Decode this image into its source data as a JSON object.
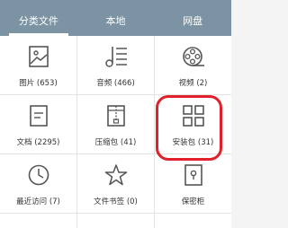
{
  "tabs": [
    {
      "label": "分类文件",
      "active": true
    },
    {
      "label": "本地",
      "active": false
    },
    {
      "label": "网盘",
      "active": false
    }
  ],
  "categories": [
    {
      "label": "图片 (653)",
      "icon": "image-icon"
    },
    {
      "label": "音频 (466)",
      "icon": "music-icon"
    },
    {
      "label": "视频 (2)",
      "icon": "video-reel-icon"
    },
    {
      "label": "文档 (2295)",
      "icon": "document-icon"
    },
    {
      "label": "压缩包 (41)",
      "icon": "archive-icon"
    },
    {
      "label": "安装包 (31)",
      "icon": "apps-grid-icon"
    },
    {
      "label": "最近访问 (7)",
      "icon": "clock-icon"
    },
    {
      "label": "文件书签 (0)",
      "icon": "star-icon"
    },
    {
      "label": "保密柜",
      "icon": "lock-icon"
    }
  ],
  "colors": {
    "header": "#7b93a2",
    "icon": "#555555",
    "highlight": "#e0202a"
  }
}
